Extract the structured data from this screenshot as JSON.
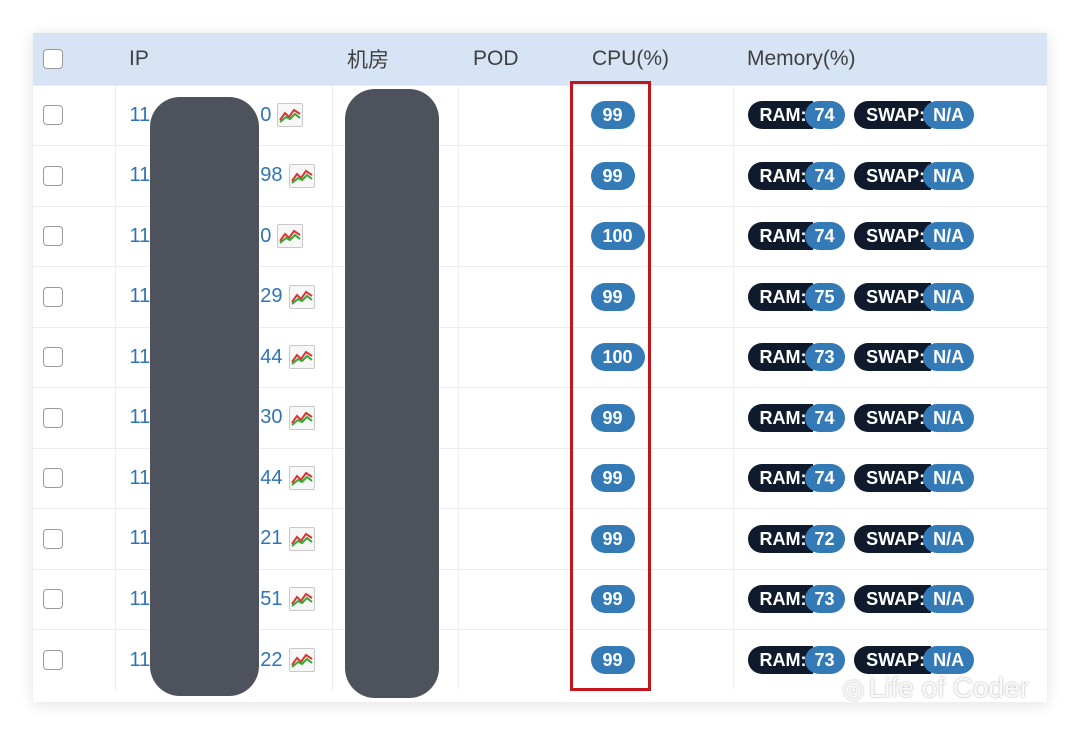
{
  "table": {
    "headers": {
      "ip": "IP",
      "room": "机房",
      "pod": "POD",
      "cpu": "CPU(%)",
      "memory": "Memory(%)"
    },
    "ram_label": "RAM:",
    "swap_label": "SWAP:",
    "rows": [
      {
        "ip_prefix": "11",
        "ip_suffix": "0",
        "cpu": "99",
        "ram": "74",
        "swap": "N/A"
      },
      {
        "ip_prefix": "11",
        "ip_suffix": "98",
        "cpu": "99",
        "ram": "74",
        "swap": "N/A"
      },
      {
        "ip_prefix": "11",
        "ip_suffix": "0",
        "cpu": "100",
        "ram": "74",
        "swap": "N/A"
      },
      {
        "ip_prefix": "11",
        "ip_suffix": "29",
        "cpu": "99",
        "ram": "75",
        "swap": "N/A"
      },
      {
        "ip_prefix": "11",
        "ip_suffix": "44",
        "cpu": "100",
        "ram": "73",
        "swap": "N/A"
      },
      {
        "ip_prefix": "11",
        "ip_suffix": "30",
        "cpu": "99",
        "ram": "74",
        "swap": "N/A"
      },
      {
        "ip_prefix": "11",
        "ip_suffix": "44",
        "cpu": "99",
        "ram": "74",
        "swap": "N/A"
      },
      {
        "ip_prefix": "11",
        "ip_suffix": "21",
        "cpu": "99",
        "ram": "72",
        "swap": "N/A"
      },
      {
        "ip_prefix": "11",
        "ip_suffix": "51",
        "cpu": "99",
        "ram": "73",
        "swap": "N/A"
      },
      {
        "ip_prefix": "11",
        "ip_suffix": "22",
        "cpu": "99",
        "ram": "73",
        "swap": "N/A"
      }
    ]
  },
  "watermark": {
    "text": "Life of Coder",
    "icon": "wechat-icon"
  },
  "colors": {
    "header_bg": "#d6e4f5",
    "badge_blue": "#337ab7",
    "badge_dark": "#0f1b2d",
    "highlight": "#c4141c",
    "link": "#2f74b5"
  }
}
